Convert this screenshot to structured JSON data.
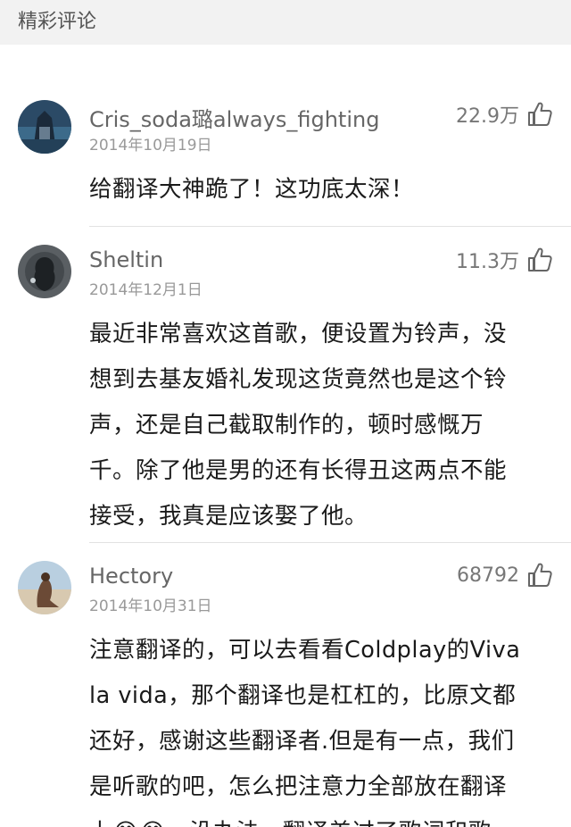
{
  "header": {
    "title": "精彩评论"
  },
  "comments": [
    {
      "user": "Cris_soda璐always_fighting",
      "date": "2014年10月19日",
      "likes": "22.9万",
      "text": "给翻译大神跪了！这功底太深！"
    },
    {
      "user": "Sheltin",
      "date": "2014年12月1日",
      "likes": "11.3万",
      "text": "最近非常喜欢这首歌，便设置为铃声，没\n想到去基友婚礼发现这货竟然也是这个铃\n声，还是自己截取制作的，顿时感慨万\n千。除了他是男的还有长得丑这两点不能\n接受，我真是应该娶了他。"
    },
    {
      "user": "Hectory",
      "date": "2014年10月31日",
      "likes": "68792",
      "text": "注意翻译的，可以去看看Coldplay的Viva\nla vida，那个翻译也是杠杠的，比原文都\n还好，感谢这些翻译者.但是有一点，我们\n是听歌的吧，怎么把注意力全部放在翻译\n上😂😂～没办法，翻译美过了歌词和歌"
    }
  ],
  "icons": {
    "like": "thumbs-up-icon"
  }
}
